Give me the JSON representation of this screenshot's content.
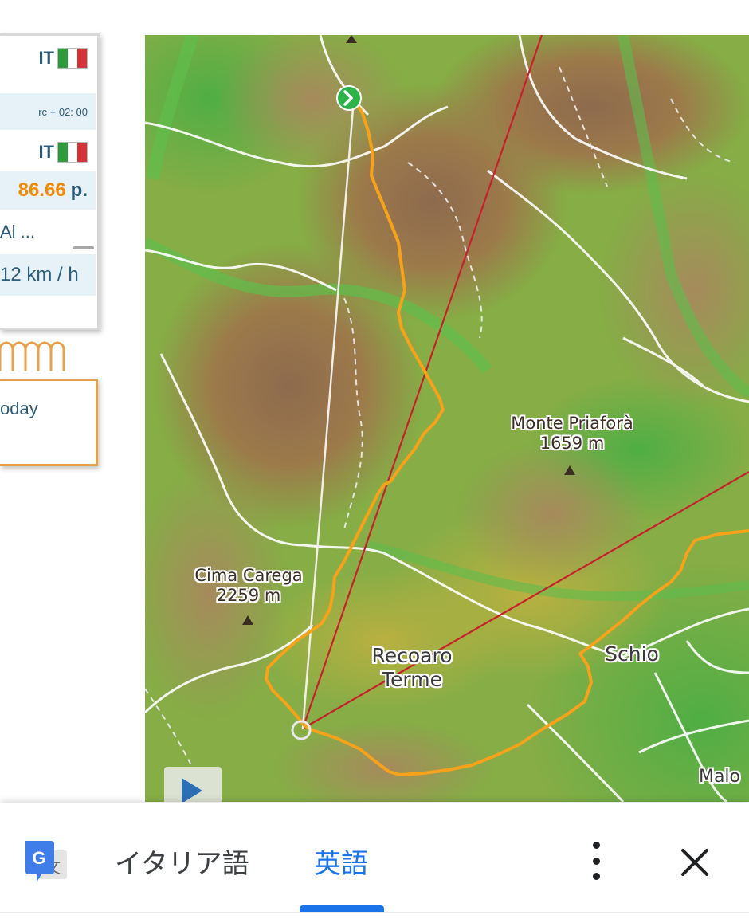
{
  "info_panel": {
    "country_1": "IT",
    "timezone": "rc + 02: 00",
    "country_2": "IT",
    "score": "86.66",
    "score_unit": "p.",
    "pilot": "Al ...",
    "speed": "12 km / h",
    "today": "oday"
  },
  "flag_colors": {
    "green": "#2e9b3a",
    "white": "#ffffff",
    "red": "#d6323a"
  },
  "map": {
    "peaks": [
      {
        "name": "Monte Priaforà",
        "elevation": "1659 m"
      },
      {
        "name": "Cima Carega",
        "elevation": "2259 m"
      }
    ],
    "towns": {
      "recoaro": "Recoaro\nTerme",
      "schio": "Schio",
      "malo": "Malo"
    },
    "track_color": "#f7a21b",
    "route_lines_color": "#c8202a",
    "start_marker_color": "#2db34a"
  },
  "translate_bar": {
    "source_language": "イタリア語",
    "target_language": "英語",
    "accent": "#1a73e8",
    "icons": [
      "google-translate-icon",
      "more-vert-icon",
      "close-icon"
    ]
  }
}
